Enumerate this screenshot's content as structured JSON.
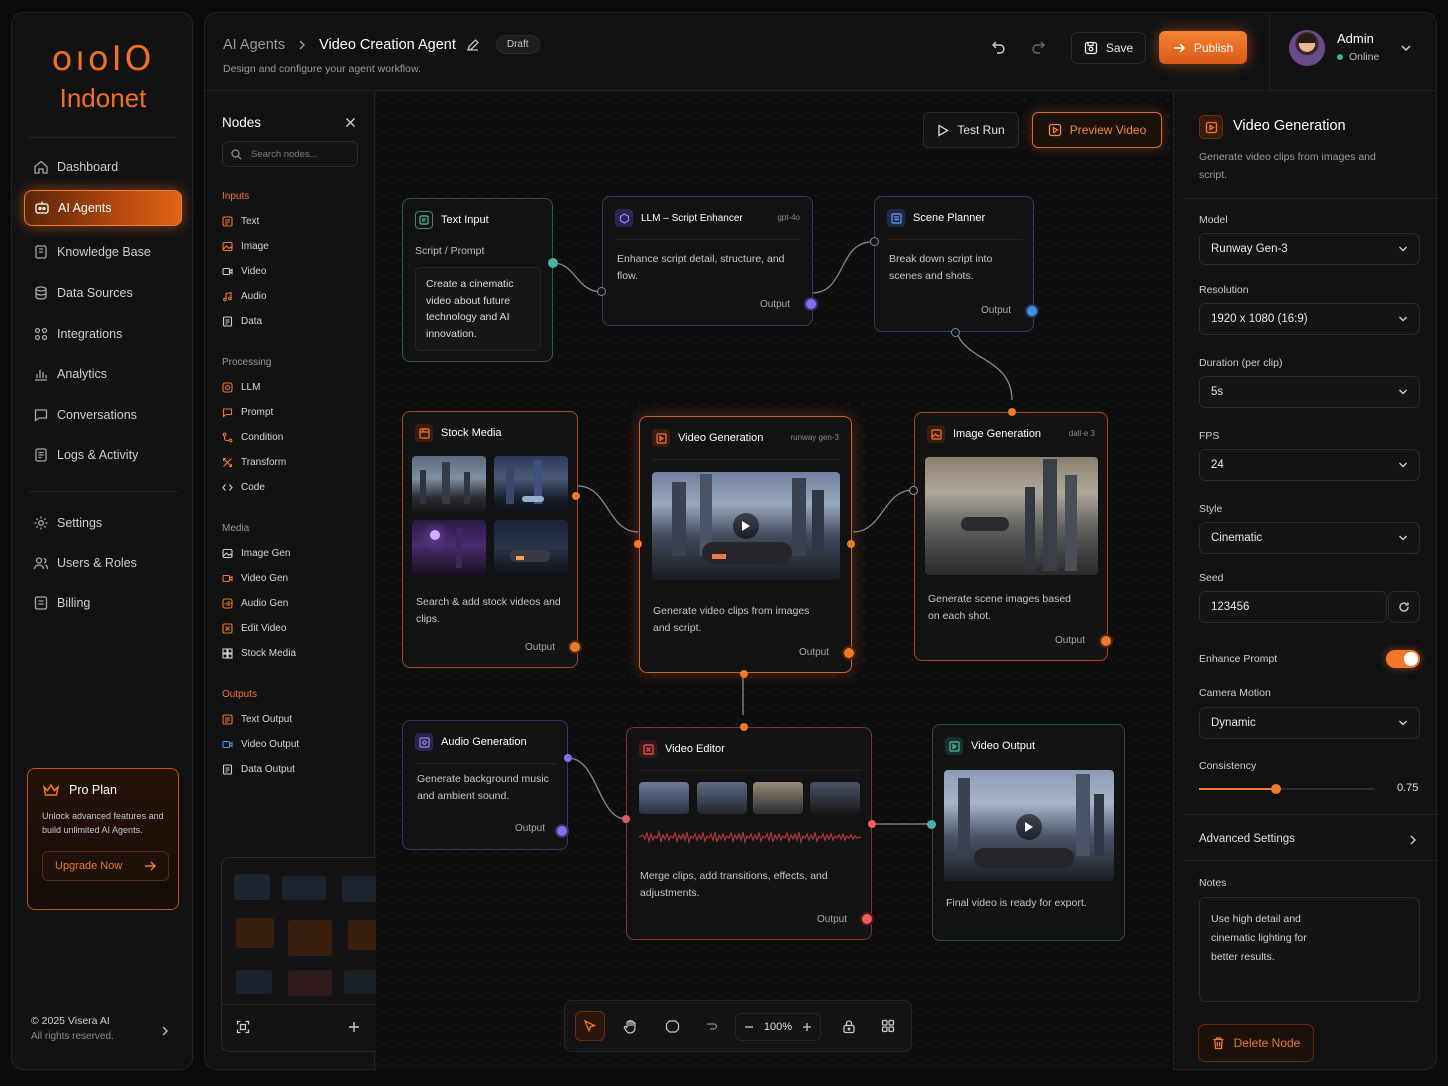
{
  "brand": {
    "logo_mark": "oıoIO",
    "name": "Indonet"
  },
  "nav": {
    "items": [
      {
        "label": "Dashboard",
        "icon": "home-icon"
      },
      {
        "label": "AI Agents",
        "icon": "agents-icon",
        "active": true
      },
      {
        "label": "Knowledge Base",
        "icon": "book-icon"
      },
      {
        "label": "Data Sources",
        "icon": "database-icon"
      },
      {
        "label": "Integrations",
        "icon": "integrations-icon"
      },
      {
        "label": "Analytics",
        "icon": "analytics-icon"
      },
      {
        "label": "Conversations",
        "icon": "chat-icon"
      },
      {
        "label": "Logs & Activity",
        "icon": "logs-icon"
      }
    ],
    "secondary": [
      {
        "label": "Settings",
        "icon": "gear-icon"
      },
      {
        "label": "Users & Roles",
        "icon": "users-icon"
      },
      {
        "label": "Billing",
        "icon": "billing-icon"
      }
    ]
  },
  "pro": {
    "title": "Pro Plan",
    "desc": "Unlock advanced features and build unlimited AI Agents.",
    "button": "Upgrade Now"
  },
  "footer": {
    "copyright": "© 2025 Visera AI",
    "rights": "All rights reserved."
  },
  "header": {
    "breadcrumb_parent": "AI Agents",
    "breadcrumb_current": "Video Creation Agent",
    "status": "Draft",
    "subtitle": "Design and configure your agent workflow.",
    "save": "Save",
    "publish": "Publish"
  },
  "user": {
    "name": "Admin",
    "status": "Online"
  },
  "nodes_panel": {
    "title": "Nodes",
    "search_placeholder": "Search nodes...",
    "sections": [
      {
        "title": "Inputs",
        "items": [
          "Text",
          "Image",
          "Video",
          "Audio",
          "Data"
        ]
      },
      {
        "title": "Processing",
        "items": [
          "LLM",
          "Prompt",
          "Condition",
          "Transform",
          "Code"
        ]
      },
      {
        "title": "Media",
        "items": [
          "Image Gen",
          "Video Gen",
          "Audio Gen",
          "Edit Video",
          "Stock Media"
        ]
      },
      {
        "title": "Outputs",
        "items": [
          "Text Output",
          "Video Output",
          "Data Output"
        ]
      }
    ]
  },
  "canvas": {
    "test_run": "Test Run",
    "preview_video": "Preview Video",
    "zoom": "100%",
    "nodes": {
      "text_input": {
        "title": "Text Input",
        "label": "Script / Prompt",
        "body": "Create a cinematic video about future technology and AI innovation."
      },
      "llm": {
        "title": "LLM – Script Enhancer",
        "tag": "gpt-4o",
        "body": "Enhance script detail, structure, and flow.",
        "output": "Output"
      },
      "scene": {
        "title": "Scene Planner",
        "body": "Break down script into scenes and shots.",
        "output": "Output"
      },
      "stock": {
        "title": "Stock Media",
        "body": "Search & add stock videos and clips.",
        "output": "Output"
      },
      "videogen": {
        "title": "Video Generation",
        "tag": "runway gen-3",
        "body": "Generate video clips from images and script.",
        "output": "Output"
      },
      "imagegen": {
        "title": "Image Generation",
        "tag": "dall-e 3",
        "body": "Generate scene images based on each shot.",
        "output": "Output"
      },
      "audiogen": {
        "title": "Audio Generation",
        "body": "Generate background music and ambient sound.",
        "output": "Output"
      },
      "editor": {
        "title": "Video Editor",
        "body": "Merge clips, add transitions, effects, and adjustments.",
        "output": "Output"
      },
      "videoout": {
        "title": "Video Output",
        "body": "Final video is ready for export."
      }
    }
  },
  "props": {
    "title": "Video Generation",
    "desc": "Generate video clips from images and script.",
    "model_label": "Model",
    "model": "Runway Gen-3",
    "resolution_label": "Resolution",
    "resolution": "1920 x 1080 (16:9)",
    "duration_label": "Duration (per clip)",
    "duration": "5s",
    "fps_label": "FPS",
    "fps": "24",
    "style_label": "Style",
    "style": "Cinematic",
    "seed_label": "Seed",
    "seed": "123456",
    "enhance_label": "Enhance Prompt",
    "enhance": true,
    "camera_label": "Camera Motion",
    "camera": "Dynamic",
    "consistency_label": "Consistency",
    "consistency": "0.75",
    "consistency_fraction": 0.75,
    "advanced": "Advanced Settings",
    "notes_label": "Notes",
    "notes": "Use high detail and cinematic lighting for better results.",
    "delete": "Delete Node"
  },
  "colors": {
    "accent": "#f07020",
    "teal": "#4fb0a0",
    "purple": "#8a6cf0",
    "blue": "#4a90e0",
    "bg": "#0b0b0c"
  }
}
